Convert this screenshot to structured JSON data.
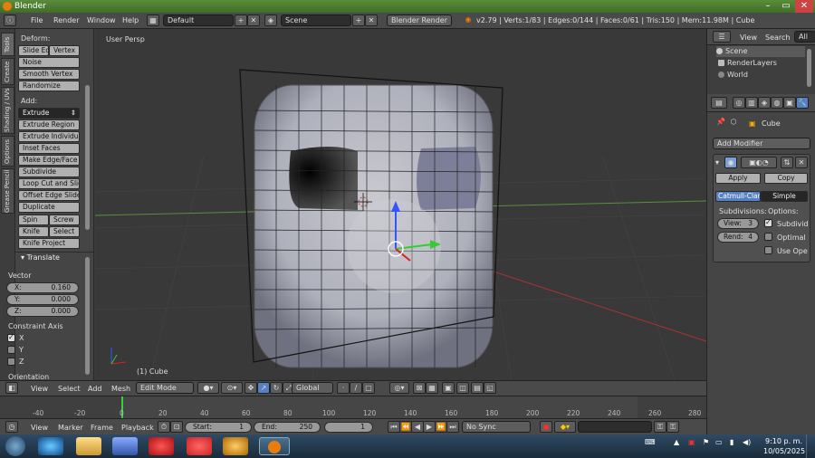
{
  "window": {
    "title": "Blender"
  },
  "info_header": {
    "menus": [
      "File",
      "Render",
      "Window",
      "Help"
    ],
    "layout": "Default",
    "scene": "Scene",
    "engine": "Blender Render",
    "stats": "v2.79 | Verts:1/83 | Edges:0/144 | Faces:0/61 | Tris:150 | Mem:11.98M | Cube"
  },
  "tool_tabs": [
    "Tools",
    "Create",
    "Shading / UVs",
    "Options",
    "Grease Pencil"
  ],
  "tool_shelf": {
    "deform_label": "Deform:",
    "deform_buttons": [
      "Slide Ed",
      "Vertex",
      "Noise",
      "Smooth Vertex",
      "Randomize"
    ],
    "add_label": "Add:",
    "extrude": "Extrude",
    "add_buttons": [
      "Extrude Region",
      "Extrude Individual",
      "Inset Faces",
      "Make Edge/Face",
      "Subdivide",
      "Loop Cut and Slide",
      "Offset Edge Slide",
      "Duplicate"
    ],
    "pair_buttons": [
      [
        "Spin",
        "Screw"
      ],
      [
        "Knife",
        "Select"
      ]
    ],
    "knife_project": "Knife Project",
    "translate_panel": "Translate",
    "vector_label": "Vector",
    "vector": [
      {
        "axis": "X:",
        "value": "0.160"
      },
      {
        "axis": "Y:",
        "value": "0.000"
      },
      {
        "axis": "Z:",
        "value": "0.000"
      }
    ],
    "constraint_label": "Constraint Axis",
    "constraint_axes": [
      "X",
      "Y",
      "Z"
    ],
    "orientation_label": "Orientation"
  },
  "viewport": {
    "view_label": "User Persp",
    "object_label": "(1) Cube"
  },
  "view3d_header": {
    "menus": [
      "View",
      "Select",
      "Add",
      "Mesh"
    ],
    "mode": "Edit Mode",
    "orientation": "Global"
  },
  "timeline": {
    "ticks": [
      "-40",
      "-20",
      "0",
      "20",
      "40",
      "60",
      "80",
      "100",
      "120",
      "140",
      "160",
      "180",
      "200",
      "220",
      "240",
      "260",
      "280"
    ],
    "menus": [
      "View",
      "Marker",
      "Frame",
      "Playback"
    ],
    "start_label": "Start:",
    "start": "1",
    "end_label": "End:",
    "end": "250",
    "current": "1",
    "sync": "No Sync"
  },
  "outliner": {
    "menus": [
      "View",
      "Search"
    ],
    "filter": "All Sc",
    "rows": [
      "Scene",
      "RenderLayers",
      "World"
    ]
  },
  "properties": {
    "object_name": "Cube",
    "add_modifier": "Add Modifier",
    "apply": "Apply",
    "copy": "Copy",
    "mode_tabs": [
      "Catmull-Clark",
      "Simple"
    ],
    "subdivisions_label": "Subdivisions:",
    "options_label": "Options:",
    "view_field": "View:",
    "view_value": "3",
    "render_field": "Rend:",
    "render_value": "4",
    "options": [
      "Subdivid",
      "Optimal",
      "Use Ope"
    ]
  },
  "taskbar": {
    "time": "9:10 p. m.",
    "date": "10/05/2025"
  },
  "colors": {
    "accent_blue": "#5680c2",
    "active_tab": "#5680c2",
    "grid_red": "#a33",
    "grid_green": "#4a4"
  }
}
